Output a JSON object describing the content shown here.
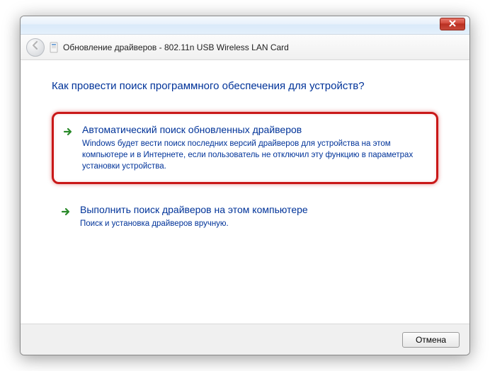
{
  "titlebar": {},
  "header": {
    "title": "Обновление драйверов - 802.11n USB Wireless LAN Card"
  },
  "content": {
    "heading": "Как провести поиск программного обеспечения для устройств?",
    "options": [
      {
        "title": "Автоматический поиск обновленных драйверов",
        "desc": "Windows будет вести поиск последних версий драйверов для устройства на этом компьютере и в Интернете, если пользователь не отключил эту функцию в параметрах установки устройства."
      },
      {
        "title": "Выполнить поиск драйверов на этом компьютере",
        "desc": "Поиск и установка драйверов вручную."
      }
    ]
  },
  "footer": {
    "cancel": "Отмена"
  }
}
